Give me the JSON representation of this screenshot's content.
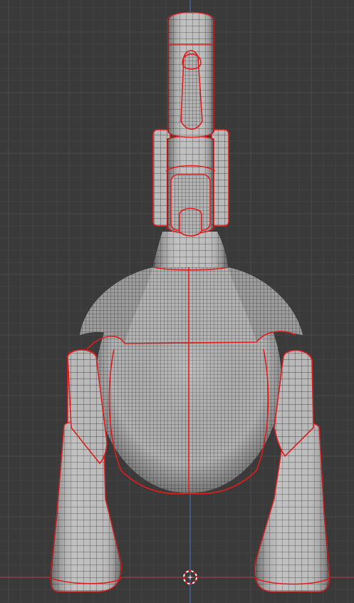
{
  "viewport": {
    "background_color": "#3a3a3a",
    "minor_grid_color": "#424242",
    "major_grid_color": "#4b4b4b",
    "x_axis_color": "#b5353e",
    "z_axis_color": "#3f6fa8",
    "mesh_fill_color": "#b9b9b9",
    "wire_color": "#2a2a2a",
    "seam_color": "#e01c1c",
    "cursor_color": "#ffffff",
    "cursor_accent_color": "#e01c1c",
    "view": "front-orthographic",
    "icons": [
      "3d-cursor-icon"
    ]
  }
}
